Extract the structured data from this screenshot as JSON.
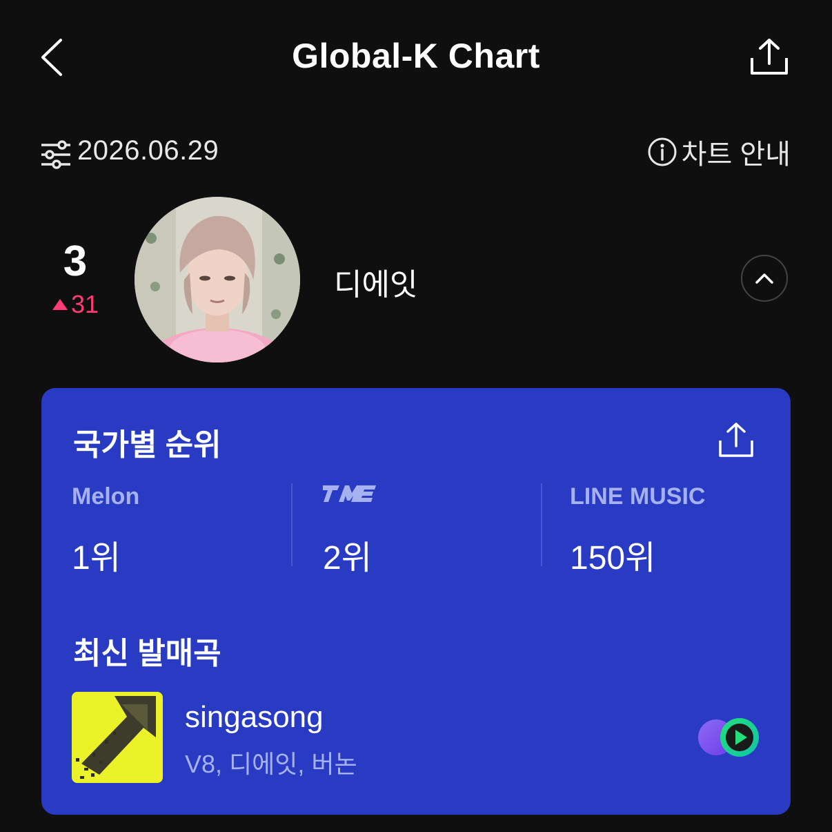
{
  "header": {
    "title": "Global-K Chart",
    "back_icon": "chevron-left-icon",
    "share_icon": "share-icon"
  },
  "date_row": {
    "filter_icon": "filter-sliders-icon",
    "date": "2026.06.29",
    "guide_icon": "info-icon",
    "guide_label": "차트 안내"
  },
  "artist": {
    "rank": "3",
    "rank_change": "31",
    "rank_change_direction": "up",
    "name": "디에잇",
    "collapse_icon": "chevron-up-icon"
  },
  "card": {
    "title": "국가별 순위",
    "share_icon": "share-icon",
    "platforms": [
      {
        "name": "Melon",
        "rank": "1위"
      },
      {
        "name": "TME",
        "rank": "2위"
      },
      {
        "name": "LINE MUSIC",
        "rank": "150위"
      }
    ],
    "latest_title": "최신 발매곡",
    "song": {
      "title": "singasong",
      "artists": "V8, 디에잇, 버논",
      "play_icon": "play-icon"
    }
  },
  "colors": {
    "background": "#0f0f10",
    "card": "#283bc2",
    "accent_up": "#ff3c73",
    "muted_text": "#a6b2f0"
  }
}
